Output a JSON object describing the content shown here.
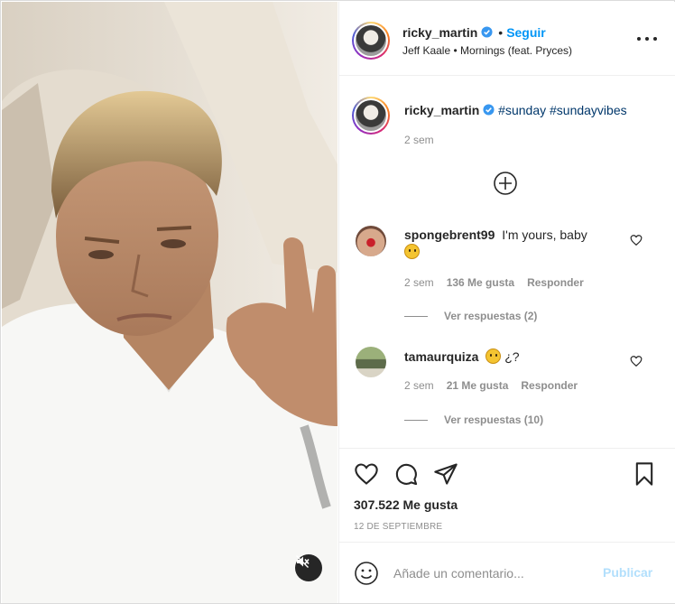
{
  "post": {
    "username": "ricky_martin",
    "follow_label": "Seguir",
    "audio": "Jeff Kaale • Mornings (feat. Pryces)",
    "caption": {
      "username": "ricky_martin",
      "hashtags": "#sunday #sundayvibes",
      "time": "2 sem"
    },
    "comments": [
      {
        "username": "spongebrent99",
        "text": "I'm yours, baby",
        "emoji": "frowning-face",
        "time": "2 sem",
        "likes": "136 Me gusta",
        "reply_label": "Responder",
        "view_replies": "Ver respuestas (2)"
      },
      {
        "username": "tamaurquiza",
        "text": "¿?",
        "emoji": "flushed-face",
        "time": "2 sem",
        "likes": "21 Me gusta",
        "reply_label": "Responder",
        "view_replies": "Ver respuestas (10)"
      }
    ],
    "likes_total": "307.522 Me gusta",
    "date": "12 DE SEPTIEMBRE",
    "add_comment_placeholder": "Añade un comentario...",
    "post_label": "Publicar"
  },
  "icons": {
    "verified": "verified-badge-icon",
    "more": "more-options-icon",
    "load_more": "plus-circle-icon",
    "like": "heart-icon",
    "comment": "comment-bubble-icon",
    "share": "paper-plane-icon",
    "save": "bookmark-icon",
    "emoji": "smiley-icon",
    "mute": "speaker-muted-icon"
  },
  "colors": {
    "link_blue": "#0095f6",
    "hashtag_blue": "#00376b",
    "muted_gray": "#8e8e8e",
    "post_disabled": "#b2dffc"
  }
}
